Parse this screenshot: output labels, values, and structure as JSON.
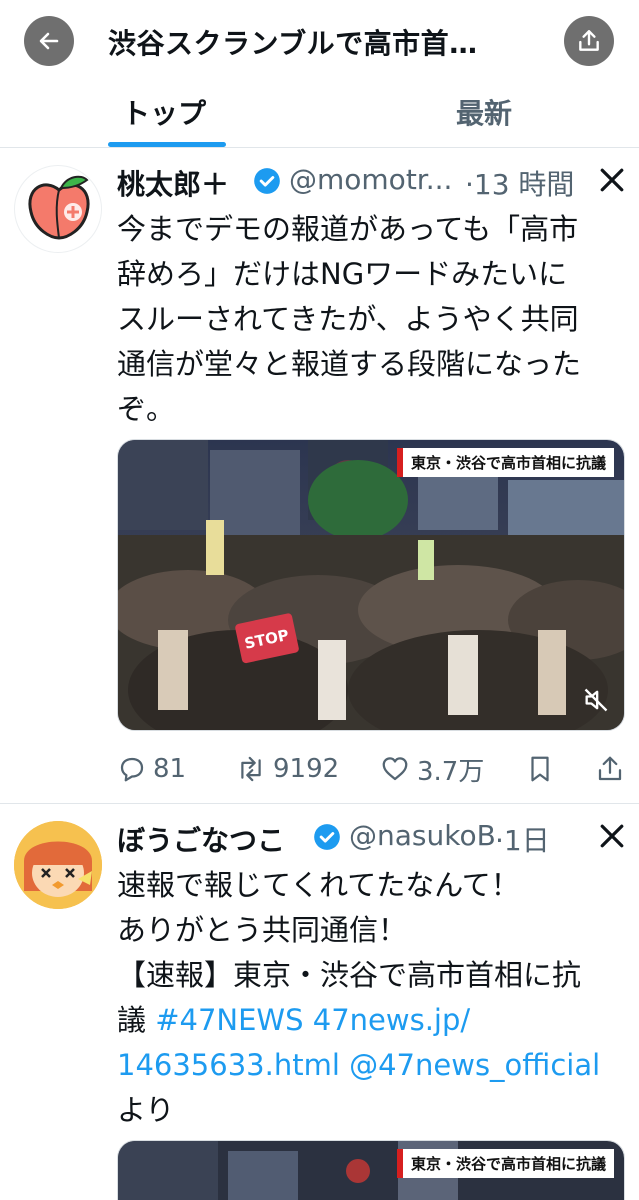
{
  "header": {
    "title": "渋谷スクランブルで高市首…",
    "back_icon": "arrow-left-icon",
    "share_icon": "share-icon"
  },
  "tabs": [
    {
      "label": "トップ",
      "active": true
    },
    {
      "label": "最新",
      "active": false
    }
  ],
  "colors": {
    "accent": "#1d9bf0",
    "secondary_text": "#536471",
    "button_bg": "#6f6f6f"
  },
  "posts": [
    {
      "display_name": "桃太郎＋",
      "handle": "@momotr...",
      "time": "·13 時間",
      "text_lines": [
        "今までデモの報道があっても「高市",
        "辞めろ」だけはNGワードみたいに",
        "スルーされてきたが、ようやく共同",
        "通信が堂々と報道する段階になった",
        "ぞ。"
      ],
      "media_banner": "東京・渋谷で高市首相に抗議",
      "media_sign": "STOP",
      "replies": "81",
      "reposts": "9192",
      "likes": "3.7万"
    },
    {
      "display_name": "ぼうごなつこ",
      "handle": "@nasukoB",
      "time": "·1日",
      "text_lines": [
        "速報で報じてくれてたなんて！",
        "ありがとう共同通信！",
        "【速報】東京・渋谷で高市首相に抗",
        "議 "
      ],
      "hashtag": "#47NEWS",
      "link1": "47news.jp/",
      "link2": "14635633.html",
      "mention": "@47news_official",
      "tail": "より",
      "media_banner": "東京・渋谷で高市首相に抗議"
    }
  ]
}
